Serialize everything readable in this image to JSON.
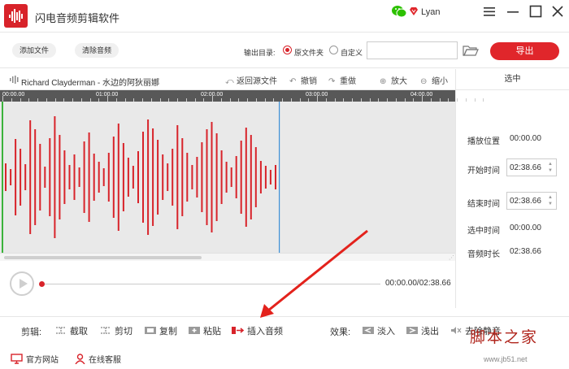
{
  "app": {
    "title": "闪电音频剪辑软件",
    "username": "Lyan"
  },
  "toolbar": {
    "add_file": "添加文件",
    "clear_audio": "清除音频",
    "output_label": "输出目录:",
    "option_source": "原文件夹",
    "option_custom": "自定义",
    "path_value": "",
    "export": "导出"
  },
  "track": {
    "name": "Richard Clayderman - 水边的阿狄丽娜",
    "restore": "返回源文件",
    "undo": "撤销",
    "redo": "重做",
    "zoom_in": "放大",
    "zoom_out": "缩小"
  },
  "ruler": {
    "labels": [
      "00:00.00",
      "01:00.00",
      "02:00.00",
      "03:00.00",
      "04:00.00"
    ]
  },
  "panel": {
    "header": "选中",
    "play_position_label": "播放位置",
    "play_position": "00:00.00",
    "start_label": "开始时间",
    "start_value": "02:38.66",
    "end_label": "结束时间",
    "end_value": "02:38.66",
    "selected_label": "选中时间",
    "selected_value": "00:00.00",
    "duration_label": "音频时长",
    "duration_value": "02:38.66"
  },
  "playback": {
    "time": "00:00.00/02:38.66",
    "progress": 0
  },
  "edit": {
    "label": "剪辑:",
    "cut": "截取",
    "trim": "剪切",
    "copy": "复制",
    "paste": "粘贴",
    "insert": "插入音频",
    "effects_label": "效果:",
    "fade_in": "淡入",
    "fade_out": "浅出",
    "remove_silence": "去除静音"
  },
  "footer": {
    "website": "官方网站",
    "support": "在线客服"
  },
  "watermark": {
    "logo": "脚本之家",
    "url": "www.jb51.net"
  },
  "colors": {
    "accent": "#e0262b",
    "wave": "#d8232a",
    "cursor": "#3c8fd6",
    "start_marker": "#3bb33b"
  }
}
